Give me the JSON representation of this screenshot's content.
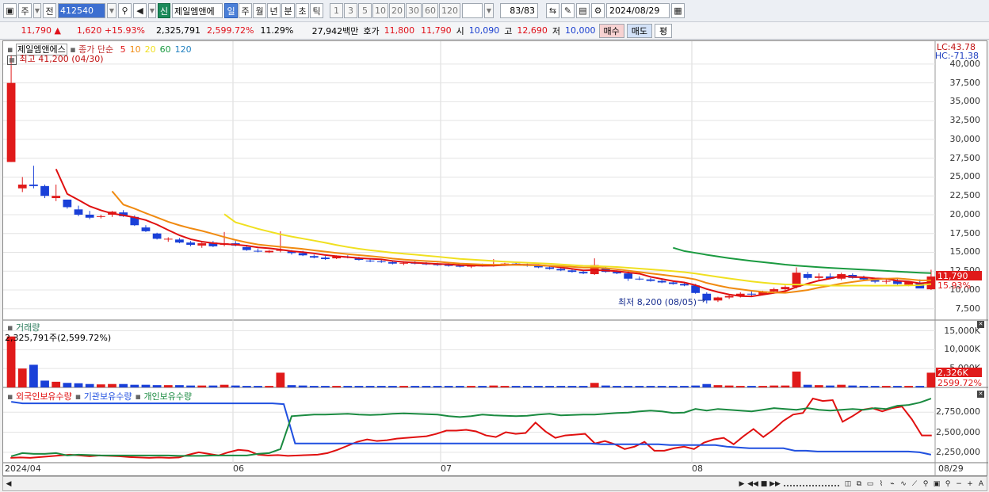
{
  "toolbar": {
    "period_type": "주",
    "prev": "전",
    "code": "412540",
    "new_label": "신",
    "name": "제일엠앤에",
    "tabs": [
      "일",
      "주",
      "월",
      "년",
      "분",
      "초",
      "틱"
    ],
    "active_tab": "일",
    "nums": [
      "1",
      "3",
      "5",
      "10",
      "20",
      "30",
      "60",
      "120"
    ],
    "count": "83/83",
    "date": "2024/08/29"
  },
  "quote": {
    "price": "11,790",
    "arrow": "▲",
    "change": "1,620",
    "pct": "+15.93%",
    "volume": "2,325,791",
    "vol_pct": "2,599.72%",
    "turnover_pct": "11.29%",
    "amount": "27,942백만",
    "hoga_label": "호가",
    "ask": "11,800",
    "bid": "11,790",
    "open_label": "시",
    "open": "10,090",
    "high_label": "고",
    "high": "12,690",
    "low_label": "저",
    "low": "10,000",
    "buy_label": "매수",
    "sell_label": "매도",
    "eval_label": "평"
  },
  "price_pane": {
    "stock_name": "제일엠앤에스",
    "ma_label": "종가 단순",
    "ma_periods": [
      "5",
      "10",
      "20",
      "60",
      "120"
    ],
    "ma_colors": [
      "#e01010",
      "#f08a10",
      "#f0e020",
      "#1a9a40",
      "#2080c0"
    ],
    "high_note": "최고 41,200 (04/30)",
    "low_note": "최저 8,200 (08/05)",
    "lc": "LC:43.78",
    "hc": "HC:-71.38",
    "y_ticks": [
      "40,000",
      "37,500",
      "35,000",
      "32,500",
      "30,000",
      "27,500",
      "25,000",
      "22,500",
      "20,000",
      "17,500",
      "15,000",
      "12,500",
      "10,000",
      "7,500"
    ],
    "last_badge": "11,790",
    "pct_badge": "15.93%"
  },
  "volume_pane": {
    "title": "거래량",
    "value_note": "2,325,791주(2,599.72%)",
    "y_ticks": [
      "15,000K",
      "10,000K",
      "5,000K"
    ],
    "last_badge": "2,326K",
    "pct_badge": "2599.72%"
  },
  "holdings_pane": {
    "series": [
      "외국인보유수량",
      "기관보유수량",
      "개인보유수량"
    ],
    "colors": [
      "#e01010",
      "#2050e0",
      "#1a8a40"
    ],
    "y_ticks": [
      "2,750,000",
      "2,500,000",
      "2,250,000"
    ]
  },
  "x_axis": {
    "labels": [
      "2024/04",
      "06",
      "07",
      "08",
      "08/29"
    ]
  },
  "chart_data": {
    "type": "candlestick",
    "candles": [
      [
        27000,
        41200,
        27000,
        37500
      ],
      [
        23500,
        25000,
        23000,
        24000
      ],
      [
        24000,
        26500,
        23500,
        23800
      ],
      [
        23800,
        24000,
        22200,
        22500
      ],
      [
        22200,
        24000,
        21800,
        22500
      ],
      [
        22000,
        22000,
        20800,
        21000
      ],
      [
        20700,
        21200,
        19800,
        20000
      ],
      [
        20000,
        20500,
        19400,
        19600
      ],
      [
        19700,
        20000,
        19500,
        19800
      ],
      [
        20000,
        20500,
        19700,
        20400
      ],
      [
        20300,
        20600,
        19700,
        19800
      ],
      [
        19700,
        19900,
        18500,
        18600
      ],
      [
        18300,
        18600,
        17700,
        17800
      ],
      [
        17500,
        17600,
        16700,
        16800
      ],
      [
        16700,
        17000,
        16400,
        16800
      ],
      [
        16700,
        16900,
        16200,
        16300
      ],
      [
        16300,
        16500,
        15800,
        16000
      ],
      [
        15900,
        16300,
        15600,
        16200
      ],
      [
        16300,
        16500,
        15700,
        15800
      ],
      [
        16000,
        17700,
        15800,
        16200
      ],
      [
        16200,
        16500,
        15800,
        15900
      ],
      [
        15700,
        16000,
        15200,
        15300
      ],
      [
        15200,
        15500,
        15000,
        15100
      ],
      [
        15000,
        15300,
        14900,
        15200
      ],
      [
        15200,
        17800,
        15000,
        15300
      ],
      [
        15100,
        15300,
        14700,
        14900
      ],
      [
        14900,
        15200,
        14500,
        14600
      ],
      [
        14500,
        14700,
        14200,
        14300
      ],
      [
        14300,
        14500,
        14000,
        14100
      ],
      [
        14200,
        14600,
        14100,
        14500
      ],
      [
        14400,
        14600,
        14200,
        14300
      ],
      [
        14200,
        14400,
        13900,
        14000
      ],
      [
        13900,
        14100,
        13700,
        13800
      ],
      [
        13800,
        14000,
        13600,
        13700
      ],
      [
        13700,
        13900,
        13400,
        13500
      ],
      [
        13500,
        13800,
        13300,
        13600
      ],
      [
        13600,
        13800,
        13400,
        13500
      ],
      [
        13500,
        13700,
        13300,
        13400
      ],
      [
        13400,
        13600,
        13200,
        13300
      ],
      [
        13300,
        13500,
        13100,
        13200
      ],
      [
        13200,
        13400,
        13000,
        13100
      ],
      [
        13100,
        13400,
        12900,
        13300
      ],
      [
        13300,
        13500,
        13100,
        13200
      ],
      [
        13200,
        14100,
        13100,
        13400
      ],
      [
        13400,
        13600,
        13200,
        13500
      ],
      [
        13500,
        13700,
        13300,
        13400
      ],
      [
        13400,
        13500,
        13100,
        13200
      ],
      [
        13200,
        13400,
        12900,
        13000
      ],
      [
        13000,
        13200,
        12700,
        12800
      ],
      [
        12800,
        13000,
        12500,
        12600
      ],
      [
        12600,
        12800,
        12300,
        12400
      ],
      [
        12400,
        12600,
        12100,
        12200
      ],
      [
        12100,
        14200,
        12000,
        13300
      ],
      [
        12900,
        13100,
        12300,
        12400
      ],
      [
        12400,
        12600,
        12100,
        12200
      ],
      [
        12200,
        12500,
        11200,
        11500
      ],
      [
        11500,
        11800,
        11300,
        11400
      ],
      [
        11400,
        11600,
        11100,
        11200
      ],
      [
        11200,
        11400,
        10900,
        11000
      ],
      [
        11000,
        11200,
        10700,
        10800
      ],
      [
        10800,
        11000,
        10500,
        10600
      ],
      [
        10600,
        10800,
        9500,
        9600
      ],
      [
        9500,
        9700,
        8200,
        8600
      ],
      [
        8600,
        9100,
        8400,
        9000
      ],
      [
        9000,
        9400,
        8800,
        9200
      ],
      [
        9200,
        9700,
        9000,
        9500
      ],
      [
        9500,
        9800,
        9200,
        9400
      ],
      [
        9400,
        9900,
        9300,
        9800
      ],
      [
        9800,
        10300,
        9600,
        10100
      ],
      [
        10100,
        10600,
        9900,
        10400
      ],
      [
        10400,
        13000,
        10200,
        12300
      ],
      [
        12100,
        12400,
        11400,
        11600
      ],
      [
        11600,
        12200,
        11300,
        11800
      ],
      [
        11800,
        12200,
        11400,
        11500
      ],
      [
        11500,
        12300,
        11300,
        12100
      ],
      [
        12000,
        12200,
        11500,
        11600
      ],
      [
        11600,
        11900,
        11200,
        11400
      ],
      [
        11300,
        11600,
        10900,
        11100
      ],
      [
        11100,
        11400,
        10800,
        11200
      ],
      [
        11200,
        11500,
        10700,
        10800
      ],
      [
        10700,
        11200,
        10500,
        11100
      ],
      [
        11000,
        11400,
        10300,
        10200
      ],
      [
        10090,
        12690,
        10000,
        11790
      ]
    ],
    "volume": [
      13500,
      5000,
      6000,
      1800,
      1500,
      1200,
      1100,
      900,
      800,
      900,
      900,
      700,
      700,
      600,
      600,
      600,
      500,
      500,
      500,
      700,
      500,
      400,
      400,
      400,
      3900,
      600,
      500,
      400,
      400,
      400,
      400,
      400,
      400,
      400,
      400,
      400,
      400,
      400,
      400,
      400,
      400,
      400,
      400,
      500,
      400,
      400,
      400,
      400,
      400,
      400,
      400,
      400,
      1200,
      500,
      400,
      400,
      400,
      400,
      400,
      400,
      400,
      500,
      900,
      600,
      500,
      400,
      400,
      400,
      500,
      500,
      4200,
      700,
      600,
      500,
      700,
      500,
      400,
      400,
      400,
      400,
      400,
      400,
      3900
    ],
    "foreign": [
      2180000,
      2185000,
      2180000,
      2190000,
      2200000,
      2210000,
      2220000,
      2210000,
      2200000,
      2210000,
      2205000,
      2200000,
      2190000,
      2185000,
      2180000,
      2185000,
      2180000,
      2185000,
      2220000,
      2250000,
      2230000,
      2210000,
      2250000,
      2280000,
      2270000,
      2220000,
      2210000,
      2215000,
      2205000,
      2210000,
      2215000,
      2220000,
      2240000,
      2280000,
      2330000,
      2380000,
      2410000,
      2390000,
      2400000,
      2420000,
      2430000,
      2440000,
      2450000,
      2480000,
      2520000,
      2520000,
      2530000,
      2510000,
      2460000,
      2440000,
      2500000,
      2480000,
      2490000,
      2620000,
      2510000,
      2430000,
      2460000,
      2470000,
      2480000,
      2360000,
      2390000,
      2350000,
      2290000,
      2320000,
      2380000,
      2270000,
      2270000,
      2300000,
      2320000,
      2290000,
      2370000,
      2410000,
      2430000,
      2350000,
      2450000,
      2540000,
      2440000,
      2530000,
      2640000,
      2720000,
      2740000,
      2920000,
      2890000,
      2900000,
      2630000,
      2700000,
      2780000,
      2800000,
      2760000,
      2800000,
      2820000,
      2660000,
      2460000,
      2460000
    ],
    "institution": [
      2880000,
      2860000,
      2860000,
      2860000,
      2860000,
      2860000,
      2860000,
      2860000,
      2860000,
      2860000,
      2860000,
      2860000,
      2860000,
      2860000,
      2860000,
      2860000,
      2860000,
      2860000,
      2860000,
      2860000,
      2860000,
      2860000,
      2860000,
      2860000,
      2850000,
      2360000,
      2360000,
      2360000,
      2360000,
      2360000,
      2360000,
      2360000,
      2360000,
      2360000,
      2360000,
      2360000,
      2360000,
      2360000,
      2360000,
      2360000,
      2360000,
      2360000,
      2360000,
      2360000,
      2360000,
      2360000,
      2360000,
      2360000,
      2360000,
      2360000,
      2360000,
      2360000,
      2350000,
      2350000,
      2350000,
      2350000,
      2350000,
      2350000,
      2340000,
      2340000,
      2340000,
      2340000,
      2340000,
      2320000,
      2310000,
      2300000,
      2300000,
      2300000,
      2300000,
      2270000,
      2270000,
      2260000,
      2260000,
      2260000,
      2260000,
      2260000,
      2260000,
      2260000,
      2260000,
      2260000,
      2250000,
      2220000
    ],
    "individual": [
      2200000,
      2240000,
      2230000,
      2230000,
      2240000,
      2210000,
      2220000,
      2215000,
      2210000,
      2210000,
      2210000,
      2210000,
      2210000,
      2210000,
      2210000,
      2205000,
      2205000,
      2205000,
      2210000,
      2210000,
      2210000,
      2210000,
      2230000,
      2240000,
      2290000,
      2700000,
      2710000,
      2720000,
      2720000,
      2725000,
      2730000,
      2720000,
      2715000,
      2720000,
      2730000,
      2735000,
      2730000,
      2725000,
      2720000,
      2700000,
      2690000,
      2700000,
      2720000,
      2710000,
      2705000,
      2700000,
      2705000,
      2720000,
      2730000,
      2710000,
      2715000,
      2720000,
      2720000,
      2730000,
      2740000,
      2745000,
      2760000,
      2770000,
      2760000,
      2740000,
      2745000,
      2790000,
      2770000,
      2790000,
      2780000,
      2770000,
      2760000,
      2780000,
      2800000,
      2790000,
      2780000,
      2800000,
      2780000,
      2770000,
      2780000,
      2790000,
      2780000,
      2800000,
      2790000,
      2830000,
      2840000,
      2870000,
      2920000
    ]
  }
}
